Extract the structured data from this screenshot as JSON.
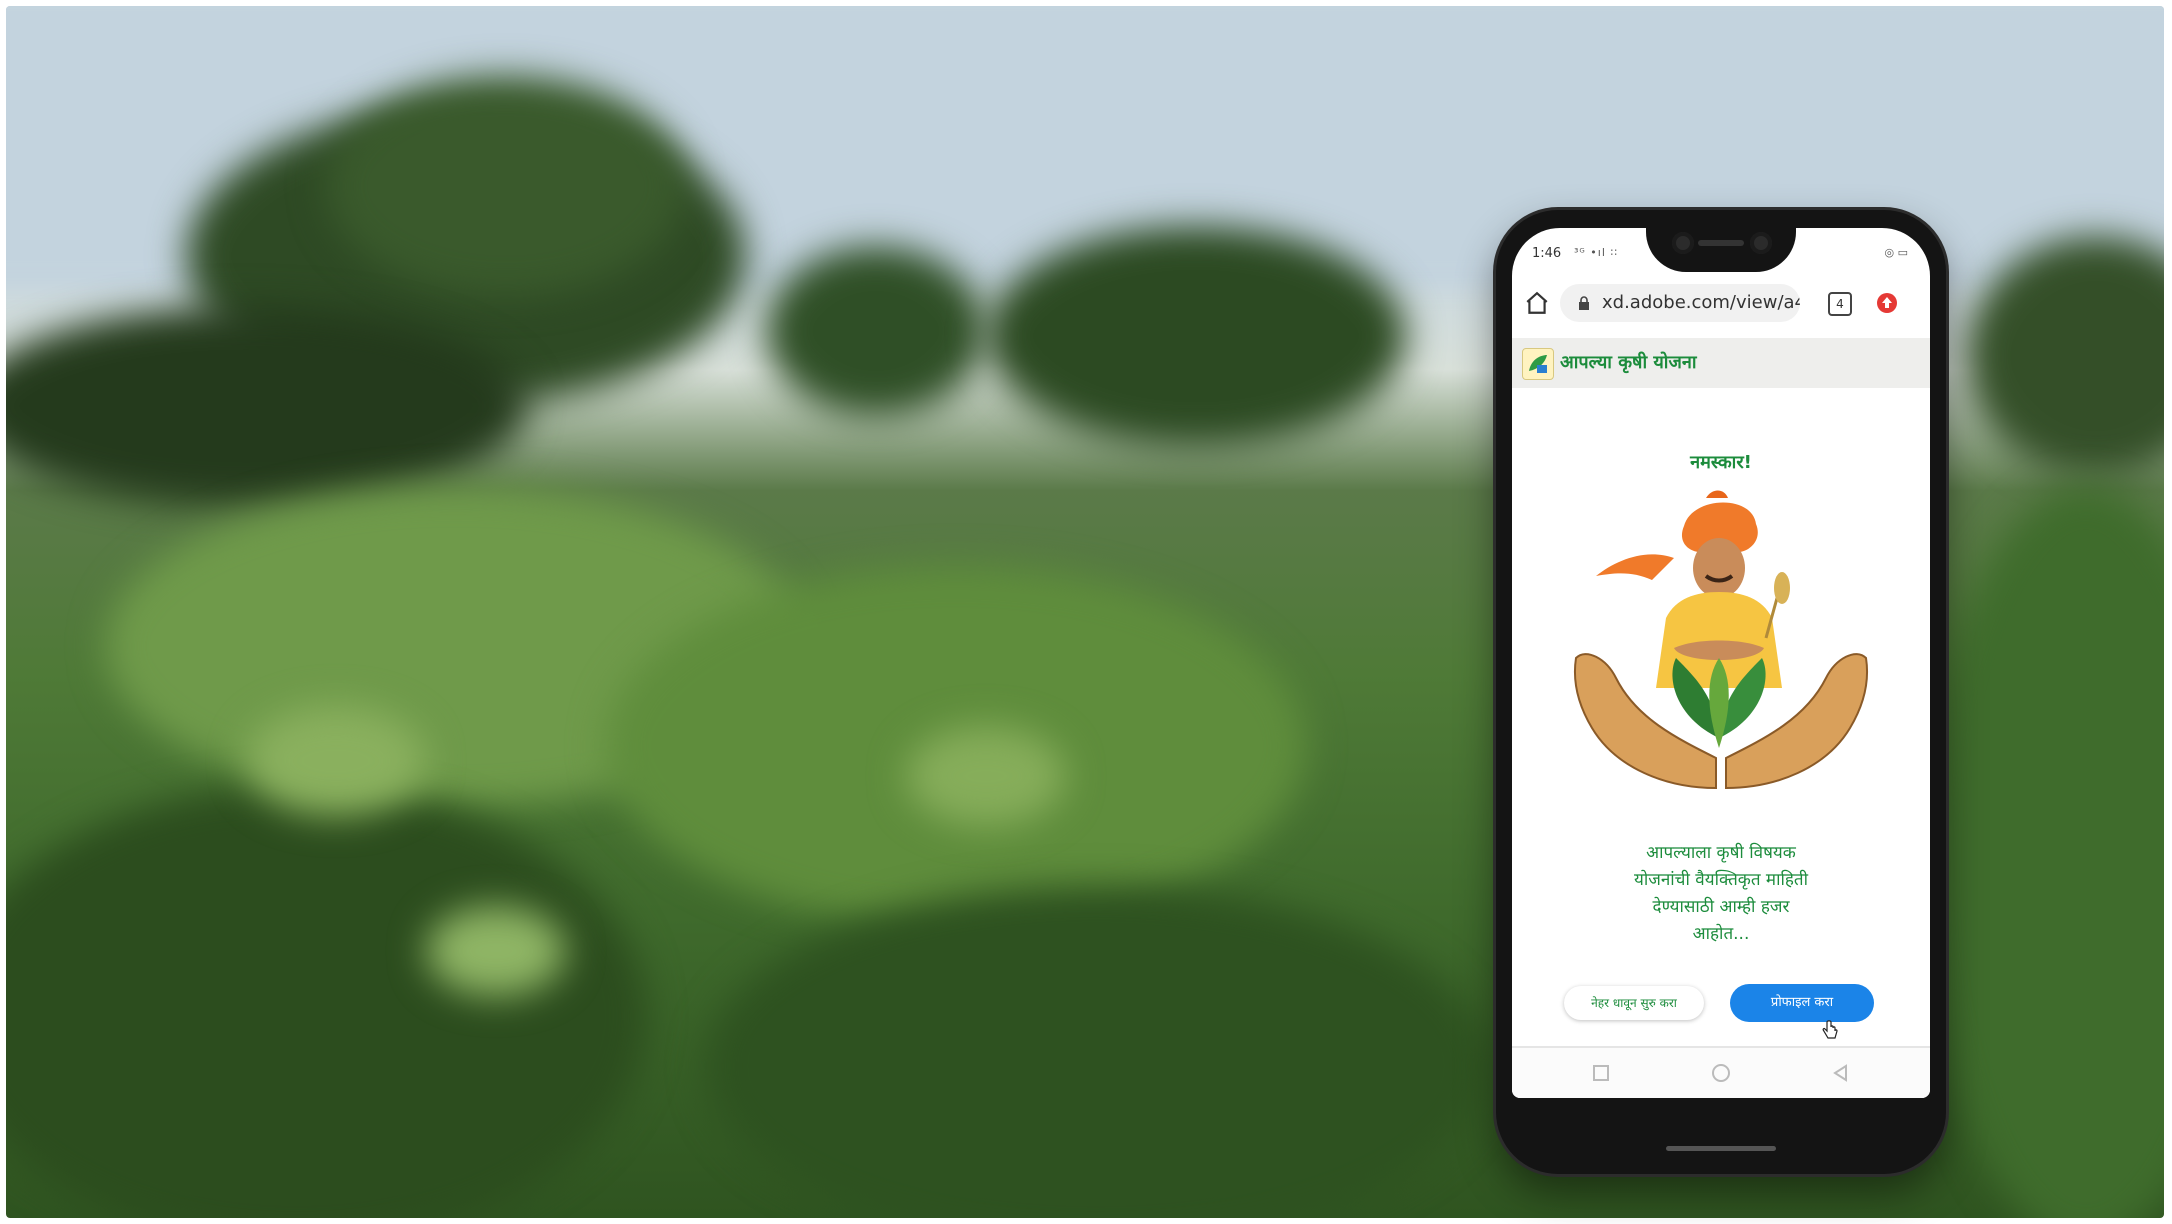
{
  "status_bar": {
    "time": "1:46",
    "signal_text": "³ᴳ •ıl ∶∶",
    "battery_text": "◎ ▭"
  },
  "browser": {
    "url": "xd.adobe.com/view/a4",
    "tab_count": "4",
    "icons": [
      "home-icon",
      "lock-icon",
      "tabs-icon",
      "extension-icon"
    ]
  },
  "app": {
    "title": "आपल्या कृषी योजना",
    "greeting": "नमस्कार!",
    "message_lines": [
      "आपल्याला कृषी विषयक",
      "योजनांची वैयक्तिकृत माहिती",
      "देण्यासाठी आम्ही हजर",
      "आहोत..."
    ],
    "skip_button": "नेहर धावून सुरु करा",
    "profile_button": "प्रोफाइल करा"
  },
  "colors": {
    "brand_green": "#1c8c3c",
    "button_blue": "#1b84e8",
    "turban_orange": "#f07a2a",
    "shirt_yellow": "#f6c542",
    "hands_tan": "#d9a05b"
  },
  "nav_icons": [
    "square-nav-icon",
    "circle-nav-icon",
    "back-triangle-icon"
  ]
}
